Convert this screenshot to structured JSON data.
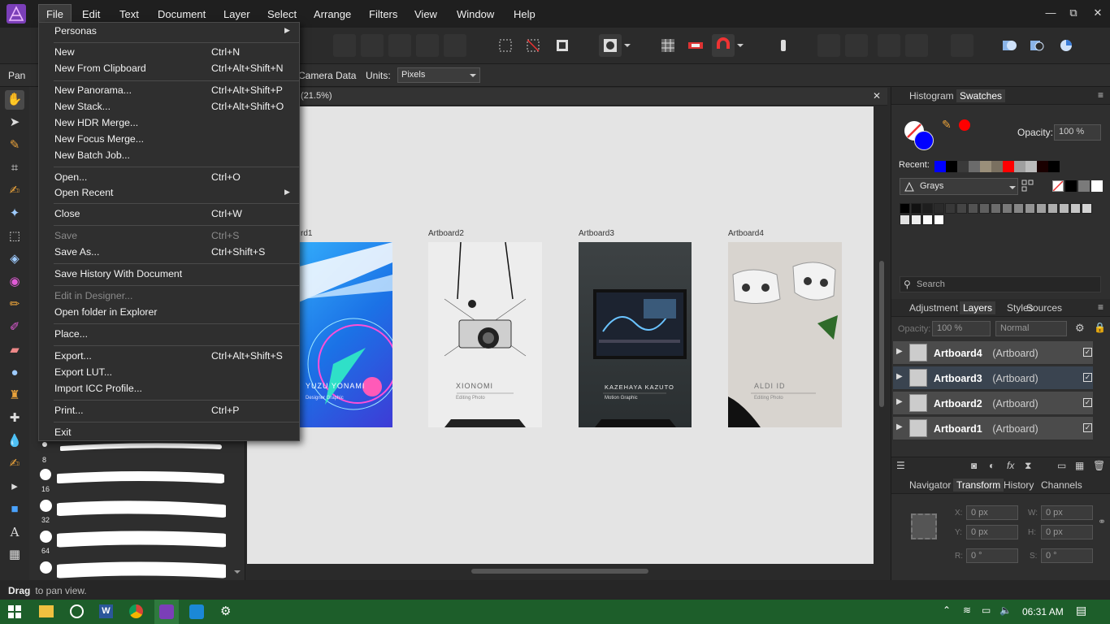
{
  "menubar": {
    "items": [
      "File",
      "Edit",
      "Text",
      "Document",
      "Layer",
      "Select",
      "Arrange",
      "Filters",
      "View",
      "Window",
      "Help"
    ],
    "controls": {
      "minimize": "—",
      "restore": "⧉",
      "close": "✕"
    }
  },
  "file_menu": {
    "items": [
      {
        "label": "Personas",
        "shortcut": "",
        "submenu": true,
        "enabled": true
      },
      {
        "label": "New",
        "shortcut": "Ctrl+N",
        "enabled": true
      },
      {
        "label": "New From Clipboard",
        "shortcut": "Ctrl+Alt+Shift+N",
        "enabled": true
      },
      {
        "label": "New Panorama...",
        "shortcut": "Ctrl+Alt+Shift+P",
        "enabled": true
      },
      {
        "label": "New Stack...",
        "shortcut": "Ctrl+Alt+Shift+O",
        "enabled": true
      },
      {
        "label": "New HDR Merge...",
        "shortcut": "",
        "enabled": true
      },
      {
        "label": "New Focus Merge...",
        "shortcut": "",
        "enabled": true
      },
      {
        "label": "New Batch Job...",
        "shortcut": "",
        "enabled": true
      },
      {
        "label": "Open...",
        "shortcut": "Ctrl+O",
        "enabled": true
      },
      {
        "label": "Open Recent",
        "shortcut": "",
        "submenu": true,
        "enabled": true
      },
      {
        "label": "Close",
        "shortcut": "Ctrl+W",
        "enabled": true
      },
      {
        "label": "Save",
        "shortcut": "Ctrl+S",
        "enabled": false
      },
      {
        "label": "Save As...",
        "shortcut": "Ctrl+Shift+S",
        "enabled": true
      },
      {
        "label": "Save History With Document",
        "shortcut": "",
        "enabled": true
      },
      {
        "label": "Edit in Designer...",
        "shortcut": "",
        "enabled": false
      },
      {
        "label": "Open folder in Explorer",
        "shortcut": "",
        "enabled": true
      },
      {
        "label": "Place...",
        "shortcut": "",
        "enabled": true
      },
      {
        "label": "Export...",
        "shortcut": "Ctrl+Alt+Shift+S",
        "enabled": true
      },
      {
        "label": "Export LUT...",
        "shortcut": "",
        "enabled": true
      },
      {
        "label": "Import ICC Profile...",
        "shortcut": "",
        "enabled": true
      },
      {
        "label": "Print...",
        "shortcut": "Ctrl+P",
        "enabled": true
      },
      {
        "label": "Exit",
        "shortcut": "",
        "enabled": true
      }
    ]
  },
  "contextbar": {
    "tool_label": "Pan",
    "camera_data": "Camera Data",
    "units_label": "Units:",
    "units_value": "Pixels"
  },
  "document": {
    "tab_title": "(21.5%)",
    "close": "✕"
  },
  "artboards": [
    {
      "label": "Artboard1",
      "visible_label": "rd1",
      "name_text": "YUZU YONAMI",
      "sub_text": "Designer Graphic"
    },
    {
      "label": "Artboard2",
      "name_text": "XIONOMI",
      "sub_text": "Editing Photo"
    },
    {
      "label": "Artboard3",
      "name_text": "KAZEHAYA KAZUTO",
      "sub_text": "Motion Graphic"
    },
    {
      "label": "Artboard4",
      "name_text": "ALDI ID",
      "sub_text": "Editing Photo"
    }
  ],
  "brush_sizes": [
    "8",
    "16",
    "32",
    "64"
  ],
  "swatches_panel": {
    "tabs": [
      "Histogram",
      "Swatches"
    ],
    "opacity_label": "Opacity:",
    "opacity_value": "100 %",
    "recent_label": "Recent:",
    "palette_name": "Grays",
    "search_placeholder": "Search",
    "recent_colors": [
      "#0000ff",
      "#000000",
      "#3a3a3a",
      "#6b6b6b",
      "#9a8f7a",
      "#7a7060",
      "#ff0000",
      "#9f9f9f",
      "#bcbcbc",
      "#1a0000",
      "#000000"
    ],
    "gray_colors": [
      "#000000",
      "#111111",
      "#1e1e1e",
      "#2b2b2b",
      "#383838",
      "#454545",
      "#525252",
      "#5f5f5f",
      "#6c6c6c",
      "#797979",
      "#868686",
      "#939393",
      "#a0a0a0",
      "#adadad",
      "#bababa",
      "#c7c7c7",
      "#d4d4d4",
      "#e1e1e1",
      "#eeeeee",
      "#fbfbfb",
      "#ffffff"
    ]
  },
  "layers_panel": {
    "tabs": [
      "Adjustment",
      "Layers",
      "Styles",
      "Sources"
    ],
    "opacity_value": "100 %",
    "blend_mode": "Normal",
    "opacity_label": "Opacity:",
    "layers": [
      {
        "name": "Artboard4",
        "type": "(Artboard)",
        "selected": false
      },
      {
        "name": "Artboard3",
        "type": "(Artboard)",
        "selected": true
      },
      {
        "name": "Artboard2",
        "type": "(Artboard)",
        "selected": false
      },
      {
        "name": "Artboard1",
        "type": "(Artboard)",
        "selected": false
      }
    ]
  },
  "transform_panel": {
    "tabs": [
      "Navigator",
      "Transform",
      "History",
      "Channels"
    ],
    "x_label": "X:",
    "x_value": "0 px",
    "y_label": "Y:",
    "y_value": "0 px",
    "w_label": "W:",
    "w_value": "0 px",
    "h_label": "H:",
    "h_value": "0 px",
    "r_label": "R:",
    "r_value": "0 °",
    "s_label": "S:",
    "s_value": "0 °"
  },
  "statusbar": {
    "bold": "Drag",
    "text": " to pan view."
  },
  "taskbar": {
    "time": "06:31 AM"
  },
  "colors": {
    "accent": "#2f4a6b",
    "primary_fill": "#0000ff",
    "secondary": "#ff0000",
    "taskbar": "#1d5e2a"
  }
}
